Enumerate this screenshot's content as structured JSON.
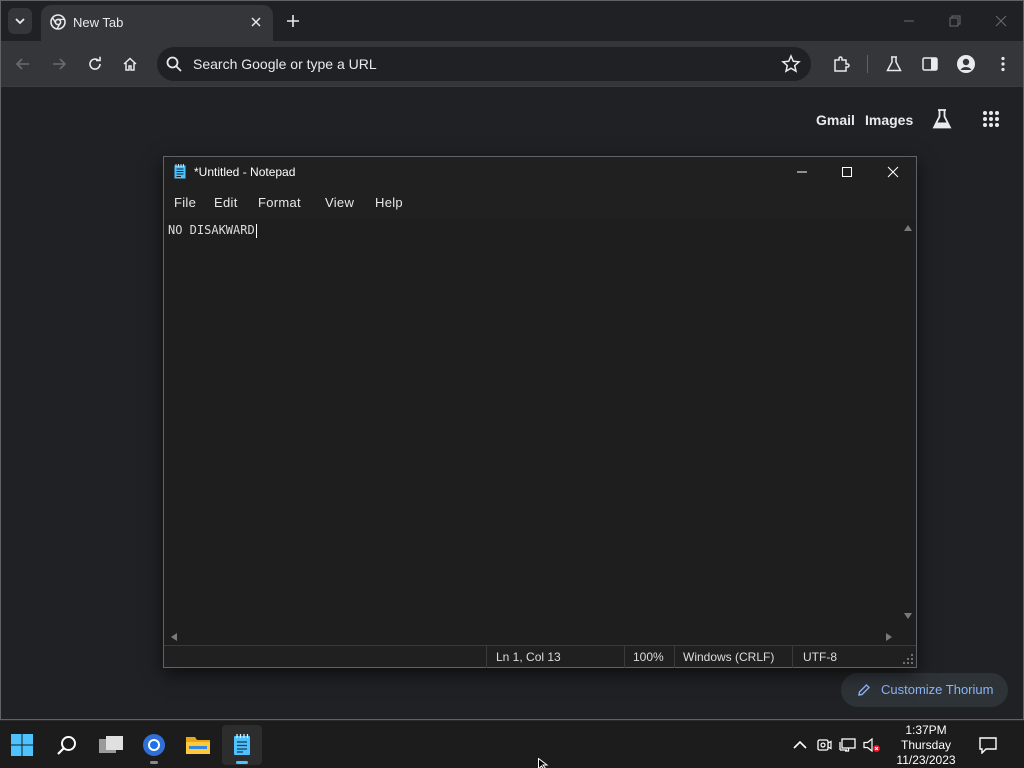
{
  "browser": {
    "tab": {
      "title": "New Tab"
    },
    "omnibox": {
      "placeholder": "Search Google or type a URL"
    },
    "ntp": {
      "gmail_label": "Gmail",
      "images_label": "Images",
      "customize_label": "Customize Thorium"
    }
  },
  "notepad": {
    "title": "*Untitled - Notepad",
    "menu": [
      "File",
      "Edit",
      "Format",
      "View",
      "Help"
    ],
    "text": "NO DISAKWARD",
    "status": {
      "position": "Ln 1, Col 13",
      "zoom": "100%",
      "line_ending": "Windows (CRLF)",
      "encoding": "UTF-8"
    }
  },
  "taskbar": {
    "clock": {
      "time": "1:37PM",
      "day": "Thursday",
      "date": "11/23/2023"
    }
  },
  "colors": {
    "browser_bg": "#202124",
    "toolbar_bg": "#35363a",
    "notepad_bg": "#202020",
    "accent": "#8ab4f8",
    "taskbar_accent": "#4cc2ff"
  }
}
